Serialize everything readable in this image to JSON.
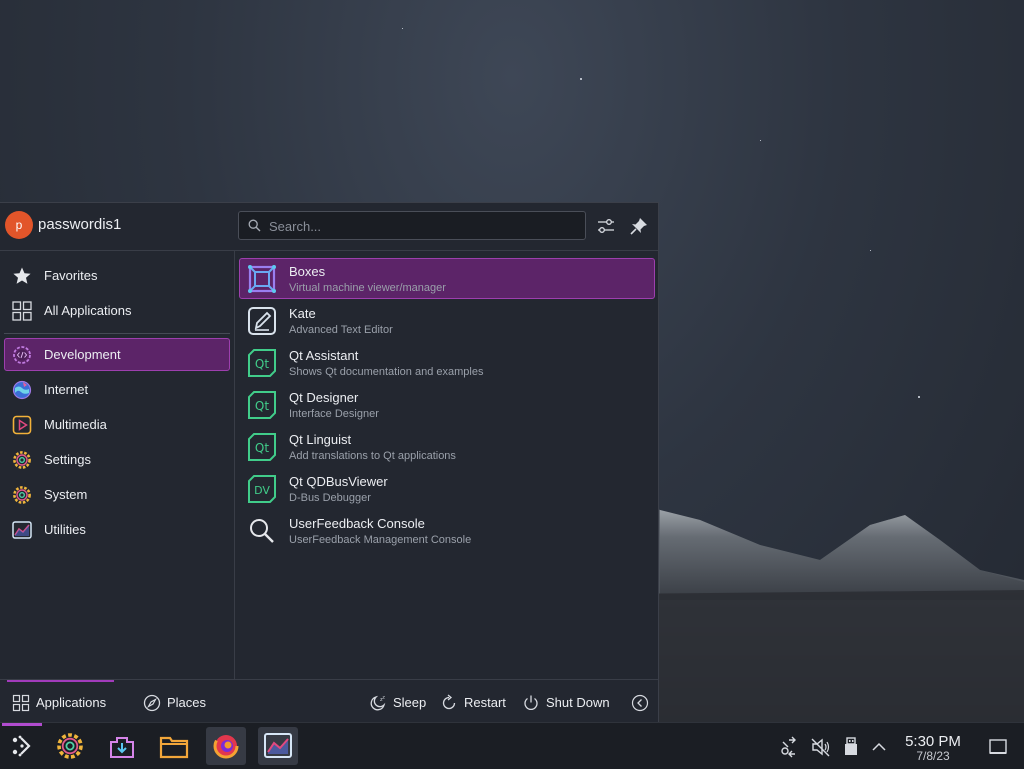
{
  "launcher": {
    "user": {
      "avatar_initial": "p",
      "name": "passwordis1"
    },
    "search": {
      "placeholder": "Search..."
    },
    "header_buttons": [
      "configure-icon",
      "pin-icon"
    ],
    "categories": [
      {
        "label": "Favorites",
        "icon": "star-icon"
      },
      {
        "label": "All Applications",
        "icon": "grid-icon"
      },
      {
        "label": "Development",
        "icon": "development-icon",
        "selected": true
      },
      {
        "label": "Internet",
        "icon": "internet-icon"
      },
      {
        "label": "Multimedia",
        "icon": "multimedia-icon"
      },
      {
        "label": "Settings",
        "icon": "settings-icon"
      },
      {
        "label": "System",
        "icon": "system-icon"
      },
      {
        "label": "Utilities",
        "icon": "utilities-icon"
      }
    ],
    "apps": [
      {
        "name": "Boxes",
        "description": "Virtual machine viewer/manager",
        "icon": "boxes-icon",
        "selected": true
      },
      {
        "name": "Kate",
        "description": "Advanced Text Editor",
        "icon": "kate-icon"
      },
      {
        "name": "Qt Assistant",
        "description": "Shows Qt documentation and examples",
        "icon": "qt-icon"
      },
      {
        "name": "Qt Designer",
        "description": "Interface Designer",
        "icon": "qt-icon"
      },
      {
        "name": "Qt Linguist",
        "description": "Add translations to Qt applications",
        "icon": "qt-icon"
      },
      {
        "name": "Qt QDBusViewer",
        "description": "D-Bus Debugger",
        "icon": "dv-icon"
      },
      {
        "name": "UserFeedback Console",
        "description": "UserFeedback Management Console",
        "icon": "magnifier-icon"
      }
    ],
    "footer": {
      "tabs": [
        {
          "label": "Applications",
          "icon": "grid-icon",
          "active": true
        },
        {
          "label": "Places",
          "icon": "compass-icon"
        }
      ],
      "actions": [
        {
          "label": "Sleep",
          "icon": "sleep-icon"
        },
        {
          "label": "Restart",
          "icon": "restart-icon"
        },
        {
          "label": "Shut Down",
          "icon": "power-icon"
        }
      ],
      "more_icon": "chevron-left-icon"
    }
  },
  "taskbar": {
    "tasks": [
      "application-launcher-icon",
      "system-settings-icon",
      "discover-icon",
      "file-manager-icon",
      "firefox-icon",
      "system-monitor-icon"
    ],
    "tray": [
      "network-icon",
      "volume-muted-icon",
      "usb-icon",
      "chevron-up-icon"
    ],
    "clock": {
      "time": "5:30 PM",
      "date": "7/8/23"
    },
    "show_desktop_icon": "show-desktop-icon"
  },
  "colors": {
    "accent": "#9d3fae",
    "selection": "#5c2468",
    "panel": "#232730",
    "taskbar": "#1b1e24"
  }
}
